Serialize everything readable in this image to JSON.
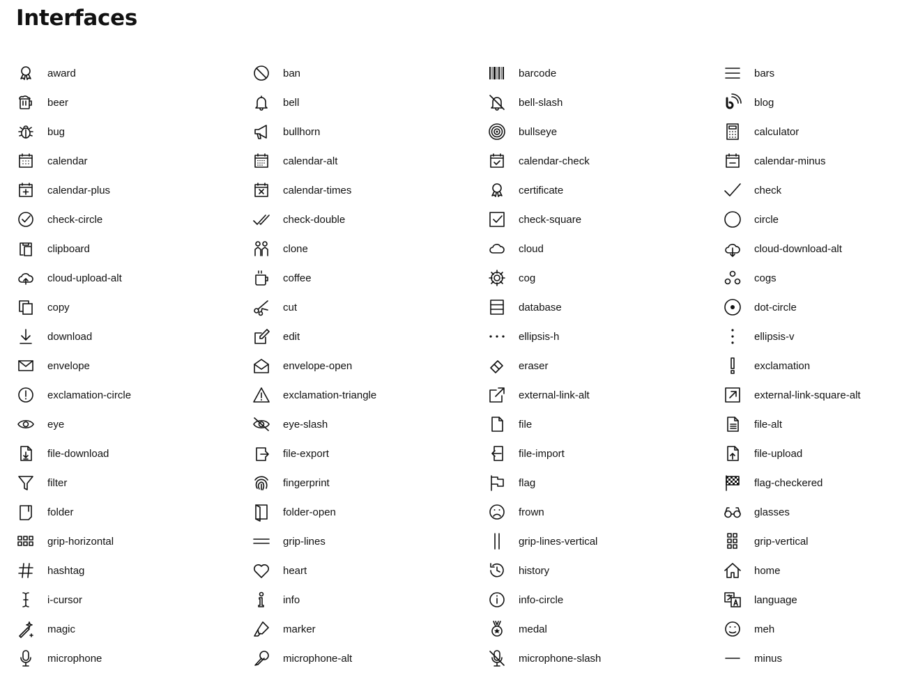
{
  "page": {
    "title": "Interfaces"
  },
  "columns": [
    [
      "award",
      "beer",
      "bug",
      "calendar",
      "calendar-plus",
      "check-circle",
      "clipboard",
      "cloud-upload-alt",
      "copy",
      "download",
      "envelope",
      "exclamation-circle",
      "eye",
      "file-download",
      "filter",
      "folder",
      "grip-horizontal",
      "hashtag",
      "i-cursor",
      "magic",
      "microphone"
    ],
    [
      "ban",
      "bell",
      "bullhorn",
      "calendar-alt",
      "calendar-times",
      "check-double",
      "clone",
      "coffee",
      "cut",
      "edit",
      "envelope-open",
      "exclamation-triangle",
      "eye-slash",
      "file-export",
      "fingerprint",
      "folder-open",
      "grip-lines",
      "heart",
      "info",
      "marker",
      "microphone-alt"
    ],
    [
      "barcode",
      "bell-slash",
      "bullseye",
      "calendar-check",
      "certificate",
      "check-square",
      "cloud",
      "cog",
      "database",
      "ellipsis-h",
      "eraser",
      "external-link-alt",
      "file",
      "file-import",
      "flag",
      "frown",
      "grip-lines-vertical",
      "history",
      "info-circle",
      "medal",
      "microphone-slash"
    ],
    [
      "bars",
      "blog",
      "calculator",
      "calendar-minus",
      "check",
      "circle",
      "cloud-download-alt",
      "cogs",
      "dot-circle",
      "ellipsis-v",
      "exclamation",
      "external-link-square-alt",
      "file-alt",
      "file-upload",
      "flag-checkered",
      "glasses",
      "grip-vertical",
      "home",
      "language",
      "meh",
      "minus"
    ]
  ]
}
